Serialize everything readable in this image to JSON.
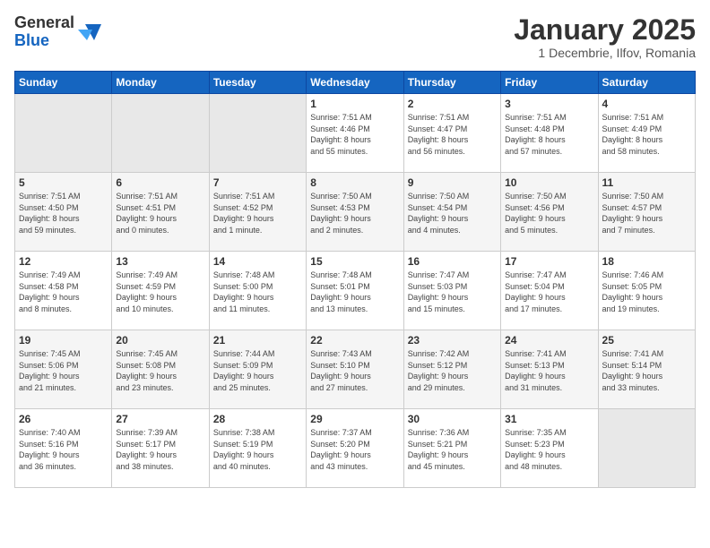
{
  "logo": {
    "general": "General",
    "blue": "Blue"
  },
  "title": "January 2025",
  "subtitle": "1 Decembrie, Ilfov, Romania",
  "headers": [
    "Sunday",
    "Monday",
    "Tuesday",
    "Wednesday",
    "Thursday",
    "Friday",
    "Saturday"
  ],
  "weeks": [
    [
      {
        "day": "",
        "info": ""
      },
      {
        "day": "",
        "info": ""
      },
      {
        "day": "",
        "info": ""
      },
      {
        "day": "1",
        "info": "Sunrise: 7:51 AM\nSunset: 4:46 PM\nDaylight: 8 hours\nand 55 minutes."
      },
      {
        "day": "2",
        "info": "Sunrise: 7:51 AM\nSunset: 4:47 PM\nDaylight: 8 hours\nand 56 minutes."
      },
      {
        "day": "3",
        "info": "Sunrise: 7:51 AM\nSunset: 4:48 PM\nDaylight: 8 hours\nand 57 minutes."
      },
      {
        "day": "4",
        "info": "Sunrise: 7:51 AM\nSunset: 4:49 PM\nDaylight: 8 hours\nand 58 minutes."
      }
    ],
    [
      {
        "day": "5",
        "info": "Sunrise: 7:51 AM\nSunset: 4:50 PM\nDaylight: 8 hours\nand 59 minutes."
      },
      {
        "day": "6",
        "info": "Sunrise: 7:51 AM\nSunset: 4:51 PM\nDaylight: 9 hours\nand 0 minutes."
      },
      {
        "day": "7",
        "info": "Sunrise: 7:51 AM\nSunset: 4:52 PM\nDaylight: 9 hours\nand 1 minute."
      },
      {
        "day": "8",
        "info": "Sunrise: 7:50 AM\nSunset: 4:53 PM\nDaylight: 9 hours\nand 2 minutes."
      },
      {
        "day": "9",
        "info": "Sunrise: 7:50 AM\nSunset: 4:54 PM\nDaylight: 9 hours\nand 4 minutes."
      },
      {
        "day": "10",
        "info": "Sunrise: 7:50 AM\nSunset: 4:56 PM\nDaylight: 9 hours\nand 5 minutes."
      },
      {
        "day": "11",
        "info": "Sunrise: 7:50 AM\nSunset: 4:57 PM\nDaylight: 9 hours\nand 7 minutes."
      }
    ],
    [
      {
        "day": "12",
        "info": "Sunrise: 7:49 AM\nSunset: 4:58 PM\nDaylight: 9 hours\nand 8 minutes."
      },
      {
        "day": "13",
        "info": "Sunrise: 7:49 AM\nSunset: 4:59 PM\nDaylight: 9 hours\nand 10 minutes."
      },
      {
        "day": "14",
        "info": "Sunrise: 7:48 AM\nSunset: 5:00 PM\nDaylight: 9 hours\nand 11 minutes."
      },
      {
        "day": "15",
        "info": "Sunrise: 7:48 AM\nSunset: 5:01 PM\nDaylight: 9 hours\nand 13 minutes."
      },
      {
        "day": "16",
        "info": "Sunrise: 7:47 AM\nSunset: 5:03 PM\nDaylight: 9 hours\nand 15 minutes."
      },
      {
        "day": "17",
        "info": "Sunrise: 7:47 AM\nSunset: 5:04 PM\nDaylight: 9 hours\nand 17 minutes."
      },
      {
        "day": "18",
        "info": "Sunrise: 7:46 AM\nSunset: 5:05 PM\nDaylight: 9 hours\nand 19 minutes."
      }
    ],
    [
      {
        "day": "19",
        "info": "Sunrise: 7:45 AM\nSunset: 5:06 PM\nDaylight: 9 hours\nand 21 minutes."
      },
      {
        "day": "20",
        "info": "Sunrise: 7:45 AM\nSunset: 5:08 PM\nDaylight: 9 hours\nand 23 minutes."
      },
      {
        "day": "21",
        "info": "Sunrise: 7:44 AM\nSunset: 5:09 PM\nDaylight: 9 hours\nand 25 minutes."
      },
      {
        "day": "22",
        "info": "Sunrise: 7:43 AM\nSunset: 5:10 PM\nDaylight: 9 hours\nand 27 minutes."
      },
      {
        "day": "23",
        "info": "Sunrise: 7:42 AM\nSunset: 5:12 PM\nDaylight: 9 hours\nand 29 minutes."
      },
      {
        "day": "24",
        "info": "Sunrise: 7:41 AM\nSunset: 5:13 PM\nDaylight: 9 hours\nand 31 minutes."
      },
      {
        "day": "25",
        "info": "Sunrise: 7:41 AM\nSunset: 5:14 PM\nDaylight: 9 hours\nand 33 minutes."
      }
    ],
    [
      {
        "day": "26",
        "info": "Sunrise: 7:40 AM\nSunset: 5:16 PM\nDaylight: 9 hours\nand 36 minutes."
      },
      {
        "day": "27",
        "info": "Sunrise: 7:39 AM\nSunset: 5:17 PM\nDaylight: 9 hours\nand 38 minutes."
      },
      {
        "day": "28",
        "info": "Sunrise: 7:38 AM\nSunset: 5:19 PM\nDaylight: 9 hours\nand 40 minutes."
      },
      {
        "day": "29",
        "info": "Sunrise: 7:37 AM\nSunset: 5:20 PM\nDaylight: 9 hours\nand 43 minutes."
      },
      {
        "day": "30",
        "info": "Sunrise: 7:36 AM\nSunset: 5:21 PM\nDaylight: 9 hours\nand 45 minutes."
      },
      {
        "day": "31",
        "info": "Sunrise: 7:35 AM\nSunset: 5:23 PM\nDaylight: 9 hours\nand 48 minutes."
      },
      {
        "day": "",
        "info": ""
      }
    ]
  ]
}
